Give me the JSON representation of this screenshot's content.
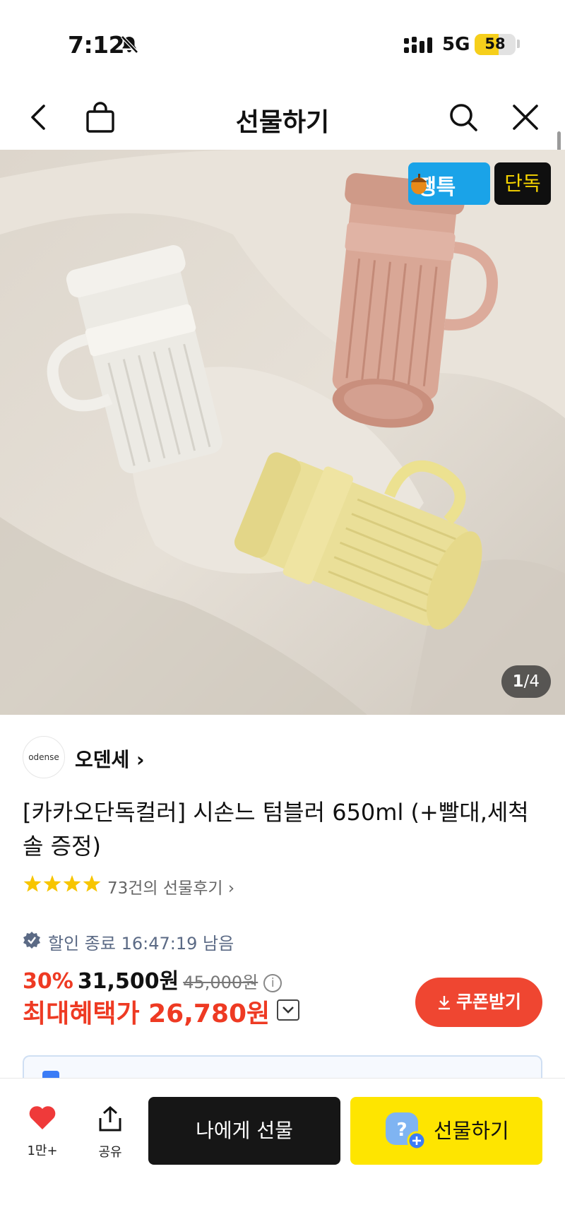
{
  "status_bar": {
    "time": "7:12",
    "network": "5G",
    "battery": "58",
    "battery_level": 0.58
  },
  "nav": {
    "title": "선물하기"
  },
  "hero": {
    "badge_jaeng": "쨍특",
    "badge_exclusive": "단독",
    "page_current": "1",
    "page_sep": "/",
    "page_total": "4"
  },
  "seller": {
    "logo_text": "odense",
    "name": "오덴세 ›"
  },
  "product": {
    "title": "[카카오단독컬러] 시손느 텀블러 650ml (+빨대,세척솔 증정)",
    "rating_stars": 4,
    "review_link": "73건의 선물후기 ›"
  },
  "pricing": {
    "timer_text": "할인 종료 16:47:19 남음",
    "discount_pct": "30%",
    "price": "31,500원",
    "original_price": "45,000원",
    "info_icon_glyph": "i",
    "max_benefit": "최대혜택가 26,780원",
    "coupon_button": "쿠폰받기"
  },
  "bottom_bar": {
    "like_count": "1만+",
    "share_label": "공유",
    "gift_self": "나에게 선물",
    "gift": "선물하기",
    "gift_icon_glyph": "?"
  },
  "colors": {
    "accent_red": "#ee3a23",
    "kakao_yellow": "#fee500",
    "badge_blue": "#1aa3e8"
  }
}
